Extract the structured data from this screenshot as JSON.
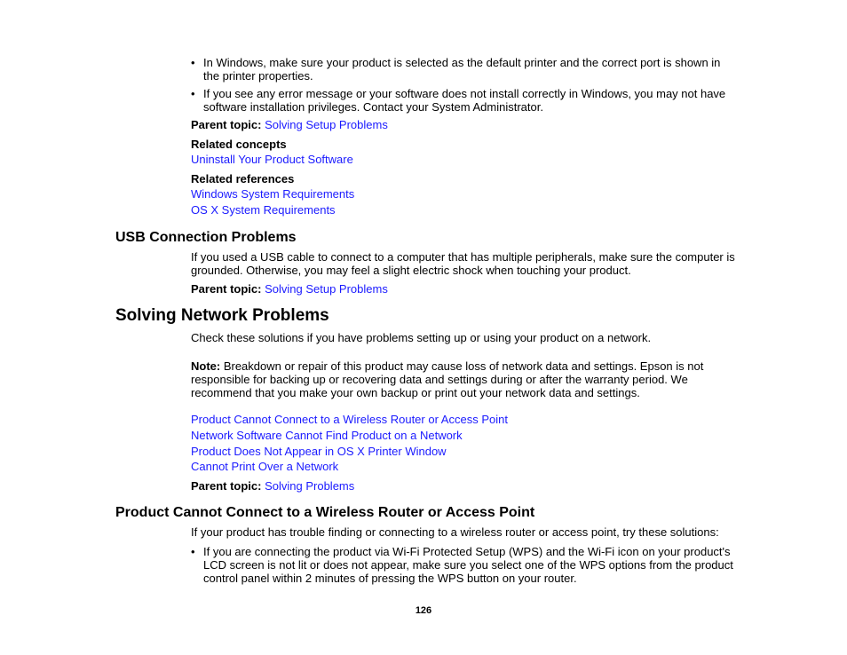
{
  "top_section": {
    "bullets": [
      "In Windows, make sure your product is selected as the default printer and the correct port is shown in the printer properties.",
      "If you see any error message or your software does not install correctly in Windows, you may not have software installation privileges. Contact your System Administrator."
    ],
    "bullet_glyph": "•",
    "parent_topic_label": "Parent topic:",
    "parent_topic_link": "Solving Setup Problems",
    "related_concepts_label": "Related concepts",
    "related_concepts": [
      "Uninstall Your Product Software"
    ],
    "related_references_label": "Related references",
    "related_references": [
      "Windows System Requirements",
      "OS X System Requirements"
    ]
  },
  "usb_section": {
    "heading": "USB Connection Problems",
    "paragraph": "If you used a USB cable to connect to a computer that has multiple peripherals, make sure the computer is grounded. Otherwise, you may feel a slight electric shock when touching your product.",
    "parent_topic_label": "Parent topic:",
    "parent_topic_link": "Solving Setup Problems"
  },
  "network_section": {
    "heading": "Solving Network Problems",
    "intro": "Check these solutions if you have problems setting up or using your product on a network.",
    "note_label": "Note:",
    "note_text": " Breakdown or repair of this product may cause loss of network data and settings. Epson is not responsible for backing up or recovering data and settings during or after the warranty period. We recommend that you make your own backup or print out your network data and settings.",
    "links": [
      "Product Cannot Connect to a Wireless Router or Access Point",
      "Network Software Cannot Find Product on a Network",
      "Product Does Not Appear in OS X Printer Window",
      "Cannot Print Over a Network"
    ],
    "parent_topic_label": "Parent topic:",
    "parent_topic_link": "Solving Problems"
  },
  "wireless_section": {
    "heading": "Product Cannot Connect to a Wireless Router or Access Point",
    "intro": "If your product has trouble finding or connecting to a wireless router or access point, try these solutions:",
    "bullets": [
      "If you are connecting the product via Wi-Fi Protected Setup (WPS) and the Wi-Fi icon on your product's LCD screen is not lit or does not appear, make sure you select one of the WPS options from the product control panel within 2 minutes of pressing the WPS button on your router."
    ]
  },
  "footer": {
    "page_number": "126"
  },
  "colors": {
    "link": "#1a1aff",
    "text": "#000000"
  }
}
